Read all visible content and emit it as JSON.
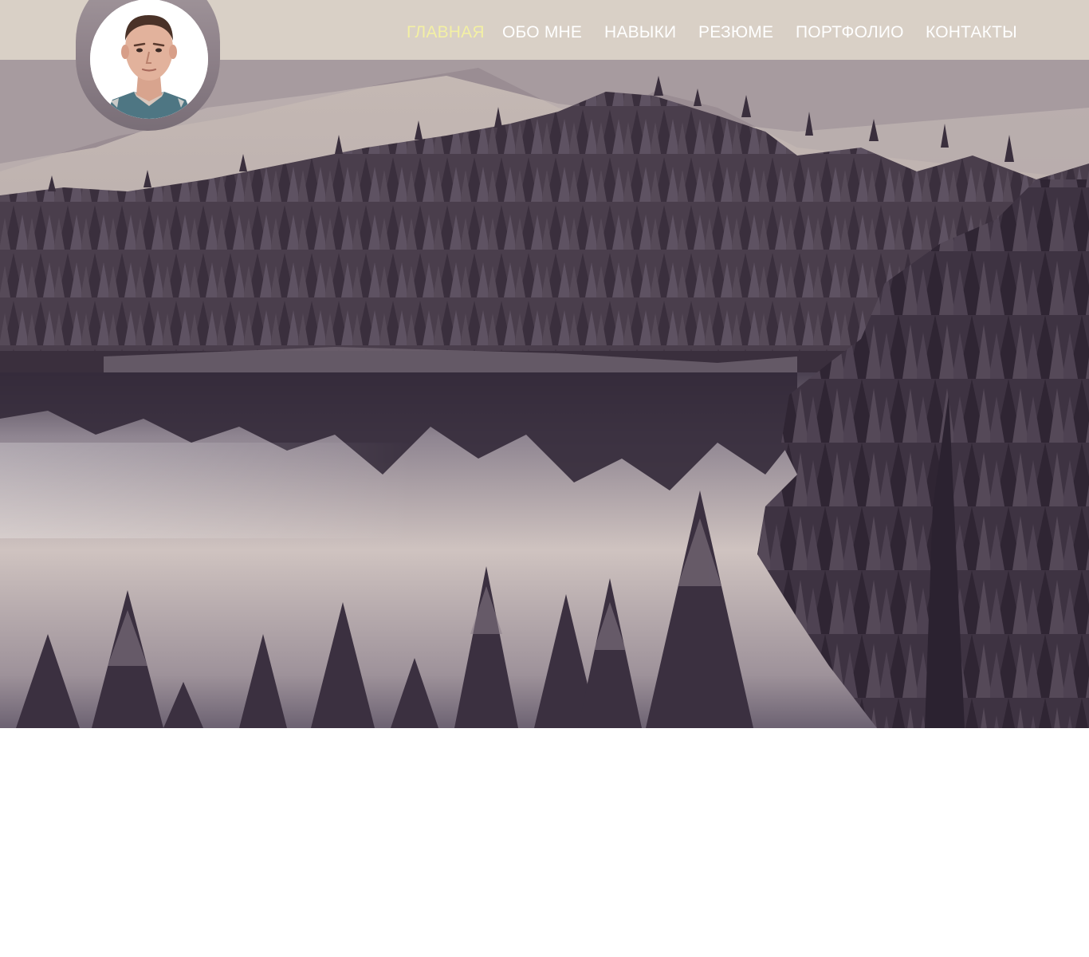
{
  "page": {
    "title": "",
    "colors": {
      "header_bg": "#d9d0c6",
      "nav_text": "#ffffff",
      "nav_active": "#f3f0a4",
      "body_bg": "#ffffff"
    }
  },
  "header": {
    "avatar_icon": "person-photo-icon",
    "nav": [
      {
        "id": "home",
        "label": "ГЛАВНАЯ",
        "active": true
      },
      {
        "id": "about",
        "label": "ОБО МНЕ",
        "active": false
      },
      {
        "id": "skills",
        "label": "НАВЫКИ",
        "active": false
      },
      {
        "id": "resume",
        "label": "РЕЗЮМЕ",
        "active": false
      },
      {
        "id": "portfolio",
        "label": "ПОРТФОЛИО",
        "active": false
      },
      {
        "id": "contacts",
        "label": "КОНТАКТЫ",
        "active": false
      }
    ]
  },
  "hero": {
    "image_icon": "forest-lake-landscape-image"
  }
}
